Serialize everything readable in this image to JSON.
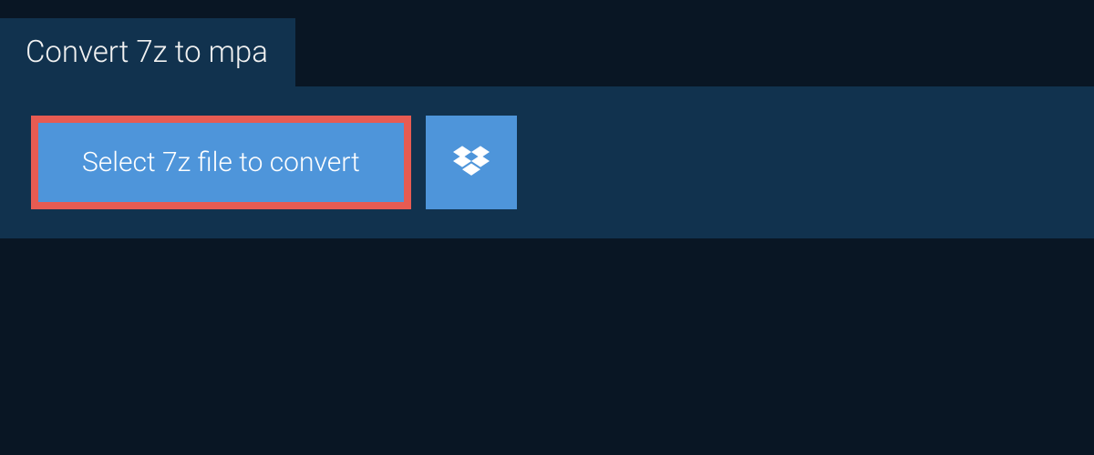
{
  "header": {
    "title": "Convert 7z to mpa"
  },
  "actions": {
    "select_file_label": "Select 7z file to convert",
    "dropbox_icon": "dropbox-icon"
  },
  "colors": {
    "background": "#091624",
    "panel": "#11324e",
    "button_bg": "#4e95da",
    "highlight_border": "#e75b52",
    "text_light": "#ffffff"
  }
}
